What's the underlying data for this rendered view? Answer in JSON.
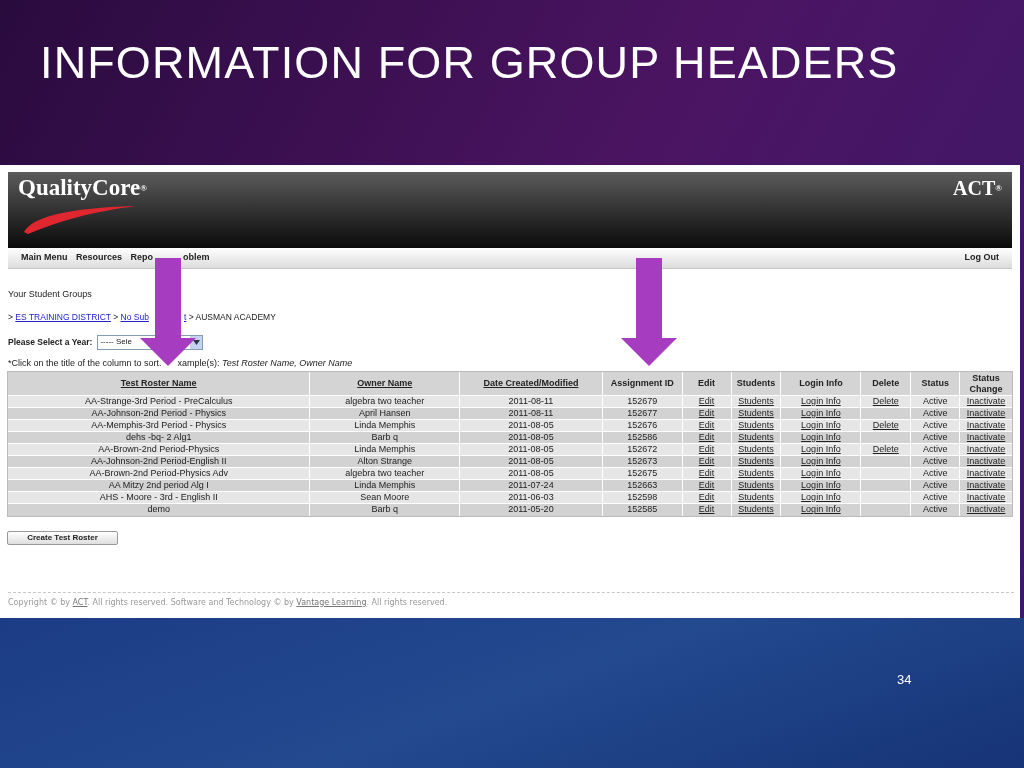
{
  "slide": {
    "title": "INFORMATION FOR GROUP HEADERS",
    "page_number": "34"
  },
  "app": {
    "logo": "QualityCore",
    "logo_mark": "®",
    "brand": "ACT",
    "brand_mark": "®",
    "nav": [
      {
        "label": "Main Menu"
      },
      {
        "label": "Resources"
      },
      {
        "label": "Repo"
      },
      {
        "label": "oblem"
      }
    ],
    "logout": "Log Out",
    "heading": "Your Student Groups",
    "breadcrumb": [
      {
        "parts": [
          {
            "text": "> ",
            "link": false
          },
          {
            "text": "ES TRAINING DISTRICT",
            "link": true
          },
          {
            "text": " > ",
            "link": false
          },
          {
            "text": "No Sub",
            "link": true
          }
        ]
      },
      {
        "parts": [
          {
            "text": "t",
            "link": true
          },
          {
            "text": " > AUSMAN ACADEMY",
            "link": false
          }
        ]
      }
    ],
    "year_label": "Please Select a Year:",
    "year_select": "----- Sele",
    "hint": [
      "*Click on the title of the column to sort.",
      "xample(s): *Test Roster Name, Owner Name*"
    ],
    "table": {
      "columns": [
        {
          "label": "Test Roster Name",
          "sortable": true
        },
        {
          "label": "Owner Name",
          "sortable": true
        },
        {
          "label": "Date Created/Modified",
          "sortable": true
        },
        {
          "label": "Assignment ID",
          "sortable": false
        },
        {
          "label": "Edit",
          "sortable": false
        },
        {
          "label": "Students",
          "sortable": false
        },
        {
          "label": "Login Info",
          "sortable": false
        },
        {
          "label": "Delete",
          "sortable": false
        },
        {
          "label": "Status",
          "sortable": false
        },
        {
          "label": "Status Change",
          "sortable": false
        }
      ],
      "rows": [
        {
          "name": "AA-Strange-3rd Period - PreCalculus",
          "owner": "algebra two teacher",
          "date": "2011-08-11",
          "id": "152679",
          "edit": "Edit",
          "students": "Students",
          "login": "Login Info",
          "delete": "Delete",
          "status": "Active",
          "change": "Inactivate"
        },
        {
          "name": "AA-Johnson-2nd Period - Physics",
          "owner": "April Hansen",
          "date": "2011-08-11",
          "id": "152677",
          "edit": "Edit",
          "students": "Students",
          "login": "Login Info",
          "status": "Active",
          "change": "Inactivate"
        },
        {
          "name": "AA-Memphis-3rd Period - Physics",
          "owner": "Linda Memphis",
          "date": "2011-08-05",
          "id": "152676",
          "edit": "Edit",
          "students": "Students",
          "login": "Login Info",
          "delete": "Delete",
          "status": "Active",
          "change": "Inactivate"
        },
        {
          "name": "dehs -bq- 2 Alg1",
          "owner": "Barb q",
          "date": "2011-08-05",
          "id": "152586",
          "edit": "Edit",
          "students": "Students",
          "login": "Login Info",
          "status": "Active",
          "change": "Inactivate"
        },
        {
          "name": "AA-Brown-2nd Period-Physics",
          "owner": "Linda Memphis",
          "date": "2011-08-05",
          "id": "152672",
          "edit": "Edit",
          "students": "Students",
          "login": "Login Info",
          "delete": "Delete",
          "status": "Active",
          "change": "Inactivate"
        },
        {
          "name": "AA-Johnson-2nd Period-English II",
          "owner": "Alton Strange",
          "date": "2011-08-05",
          "id": "152673",
          "edit": "Edit",
          "students": "Students",
          "login": "Login Info",
          "status": "Active",
          "change": "Inactivate"
        },
        {
          "name": "AA-Brown-2nd Period-Physics Adv",
          "owner": "algebra two teacher",
          "date": "2011-08-05",
          "id": "152675",
          "edit": "Edit",
          "students": "Students",
          "login": "Login Info",
          "status": "Active",
          "change": "Inactivate"
        },
        {
          "name": "AA Mitzy 2nd period Alg I",
          "owner": "Linda Memphis",
          "date": "2011-07-24",
          "id": "152663",
          "edit": "Edit",
          "students": "Students",
          "login": "Login Info",
          "status": "Active",
          "change": "Inactivate"
        },
        {
          "name": "AHS - Moore - 3rd - English II",
          "owner": "Sean Moore",
          "date": "2011-06-03",
          "id": "152598",
          "edit": "Edit",
          "students": "Students",
          "login": "Login Info",
          "status": "Active",
          "change": "Inactivate"
        },
        {
          "name": "demo",
          "owner": "Barb q",
          "date": "2011-05-20",
          "id": "152585",
          "edit": "Edit",
          "students": "Students",
          "login": "Login Info",
          "status": "Active",
          "change": "Inactivate"
        }
      ]
    },
    "create_button": "Create Test Roster",
    "footer": [
      {
        "text": "Copyright © by ",
        "link": false
      },
      {
        "text": "ACT",
        "link": true
      },
      {
        "text": ". All rights reserved. Software and Technology © by ",
        "link": false
      },
      {
        "text": "Vantage Learning",
        "link": true
      },
      {
        "text": ". All rights reserved.",
        "link": false
      }
    ]
  },
  "annotations": [
    {
      "kind": "down-arrow"
    },
    {
      "kind": "down-arrow"
    }
  ]
}
